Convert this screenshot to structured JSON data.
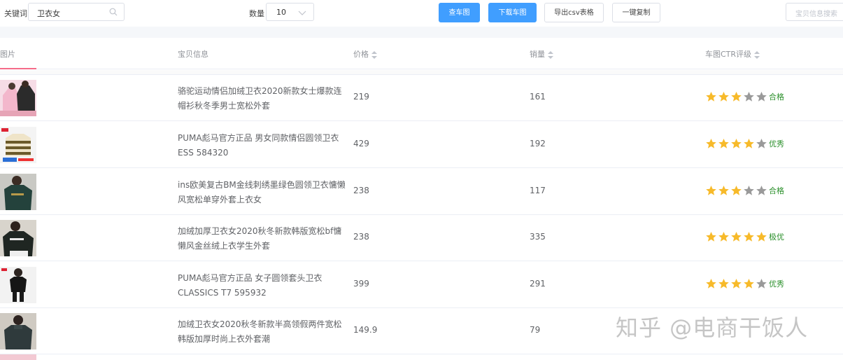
{
  "toolbar": {
    "keyword_label": "关键词",
    "keyword_value": "卫衣女",
    "quantity_label": "数量",
    "quantity_value": "10",
    "buttons": {
      "check_image": "查车图",
      "download_image": "下载车图",
      "export_csv": "导出csv表格",
      "copy_all": "一键复制"
    },
    "search_placeholder": "宝贝信息搜索"
  },
  "table": {
    "headers": {
      "image": "图片",
      "info": "宝贝信息",
      "price": "价格",
      "sales": "销量",
      "rating": "车图CTR评级"
    },
    "rows": [
      {
        "title": "骆驼运动情侣加绒卫衣2020新款女士爆款连帽衫秋冬季男士宽松外套",
        "price": "219",
        "sales": "161",
        "stars": 3,
        "grade": "合格",
        "thumb": "pink-hoodies"
      },
      {
        "title": "PUMA彪马官方正品 男女同款情侣圆领卫衣ESS 584320",
        "price": "429",
        "sales": "192",
        "stars": 4,
        "grade": "优秀",
        "thumb": "striped-sweater"
      },
      {
        "title": "ins欧美复古BM金线刺绣墨绿色圆领卫衣慵懒风宽松单穿外套上衣女",
        "price": "238",
        "sales": "117",
        "stars": 3,
        "grade": "合格",
        "thumb": "green-sweatshirt"
      },
      {
        "title": "加绒加厚卫衣女2020秋冬新款韩版宽松bf慵懒风金丝绒上衣学生外套",
        "price": "238",
        "sales": "335",
        "stars": 5,
        "grade": "极优",
        "thumb": "black-sweatshirt"
      },
      {
        "title": "PUMA彪马官方正品 女子圆领套头卫衣 CLASSICS T7 595932",
        "price": "399",
        "sales": "291",
        "stars": 4,
        "grade": "优秀",
        "thumb": "black-top-model"
      },
      {
        "title": "加绒卫衣女2020秋冬新款半高领假两件宽松韩版加厚时尚上衣外套潮",
        "price": "149.9",
        "sales": "79",
        "stars": 0,
        "grade": "",
        "thumb": "dark-hoodie-model"
      }
    ]
  },
  "watermark": "知乎 @电商干饭人",
  "colors": {
    "primary": "#409eff",
    "star_on": "#f7ba2a",
    "star_off": "#9a9a9a",
    "grade_text": "#2a8f2a",
    "header_underline": "#f56c8a"
  },
  "icons": {
    "keyword_input": "search-icon",
    "quantity_select": "chevron-down-icon",
    "sort": "sort-caret-icon",
    "rating": "star-icon"
  }
}
